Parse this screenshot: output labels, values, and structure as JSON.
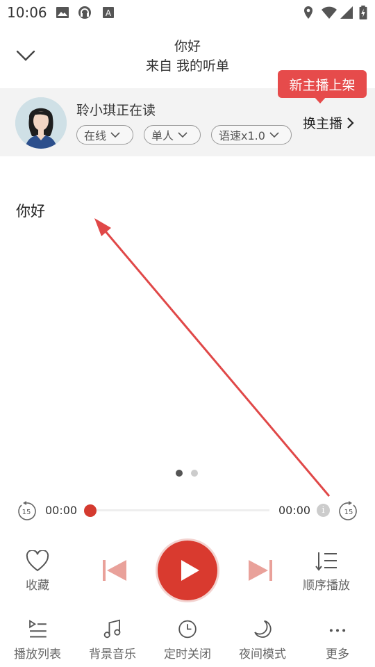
{
  "status_bar": {
    "time": "10:06",
    "left_icons": [
      "image-icon",
      "headset-icon",
      "font-icon"
    ],
    "right_icons": [
      "location-icon",
      "wifi-icon",
      "signal-icon",
      "battery-icon"
    ]
  },
  "header": {
    "title": "你好",
    "subtitle": "来自 我的听单"
  },
  "reader": {
    "name": "聆小琪正在读",
    "chips": [
      "在线",
      "单人",
      "语速x1.0"
    ],
    "switch_label": "换主播",
    "badge": "新主播上架"
  },
  "content": {
    "text": "你好",
    "pages": 2,
    "current_page": 1
  },
  "player": {
    "current_time": "00:00",
    "total_time": "00:00",
    "progress": 0,
    "rewind_label": "15",
    "forward_label": "15",
    "favorite_label": "收藏",
    "order_label": "顺序播放"
  },
  "bottom_nav": [
    {
      "label": "播放列表",
      "icon": "playlist-icon"
    },
    {
      "label": "背景音乐",
      "icon": "music-note-icon"
    },
    {
      "label": "定时关闭",
      "icon": "clock-icon"
    },
    {
      "label": "夜间模式",
      "icon": "moon-icon"
    },
    {
      "label": "更多",
      "icon": "more-icon"
    }
  ],
  "colors": {
    "accent": "#d93a2f",
    "badge": "#e64b4b",
    "panel_bg": "#f3f3f3",
    "annotation_arrow": "#e04848"
  }
}
